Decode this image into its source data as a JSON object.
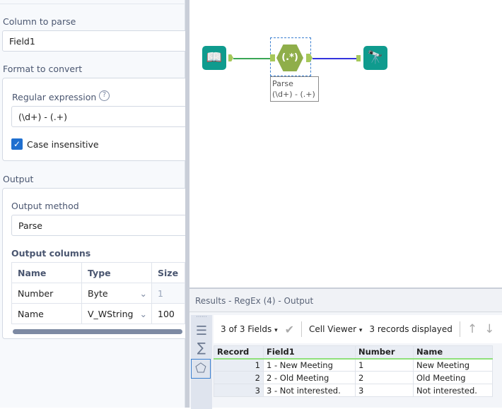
{
  "config": {
    "column_to_parse_label": "Column to parse",
    "column_to_parse_value": "Field1",
    "format_label": "Format to convert",
    "regex_label": "Regular expression",
    "regex_value": "(\\d+) - (.+)",
    "case_insensitive_label": "Case insensitive",
    "case_insensitive_checked": true,
    "output_label": "Output",
    "output_method_label": "Output method",
    "output_method_value": "Parse",
    "output_columns_label": "Output columns",
    "columns_headers": [
      "Name",
      "Type",
      "Size"
    ],
    "columns_rows": [
      [
        "Number",
        "Byte",
        "1"
      ],
      [
        "Name",
        "V_WString",
        "100"
      ]
    ]
  },
  "canvas": {
    "tool_label_line1": "Parse",
    "tool_label_line2": "(\\d+) - (.+)",
    "regex_glyph": "(.*)"
  },
  "results": {
    "title": "Results - RegEx (4) - Output",
    "fields": "3 of 3 Fields",
    "viewer": "Cell Viewer",
    "records": "3 records displayed",
    "headers": [
      "Record",
      "Field1",
      "Number",
      "Name"
    ],
    "rows": [
      [
        "1",
        "1 - New Meeting",
        "1",
        "New Meeting"
      ],
      [
        "2",
        "2 - Old Meeting",
        "2",
        "Old Meeting"
      ],
      [
        "3",
        "3 - Not interested.",
        "3",
        "Not interested."
      ]
    ]
  },
  "colors": {
    "accent": "#1f6fcf",
    "node_teal": "#0f9b8e",
    "regex_green": "#8fae4a"
  }
}
